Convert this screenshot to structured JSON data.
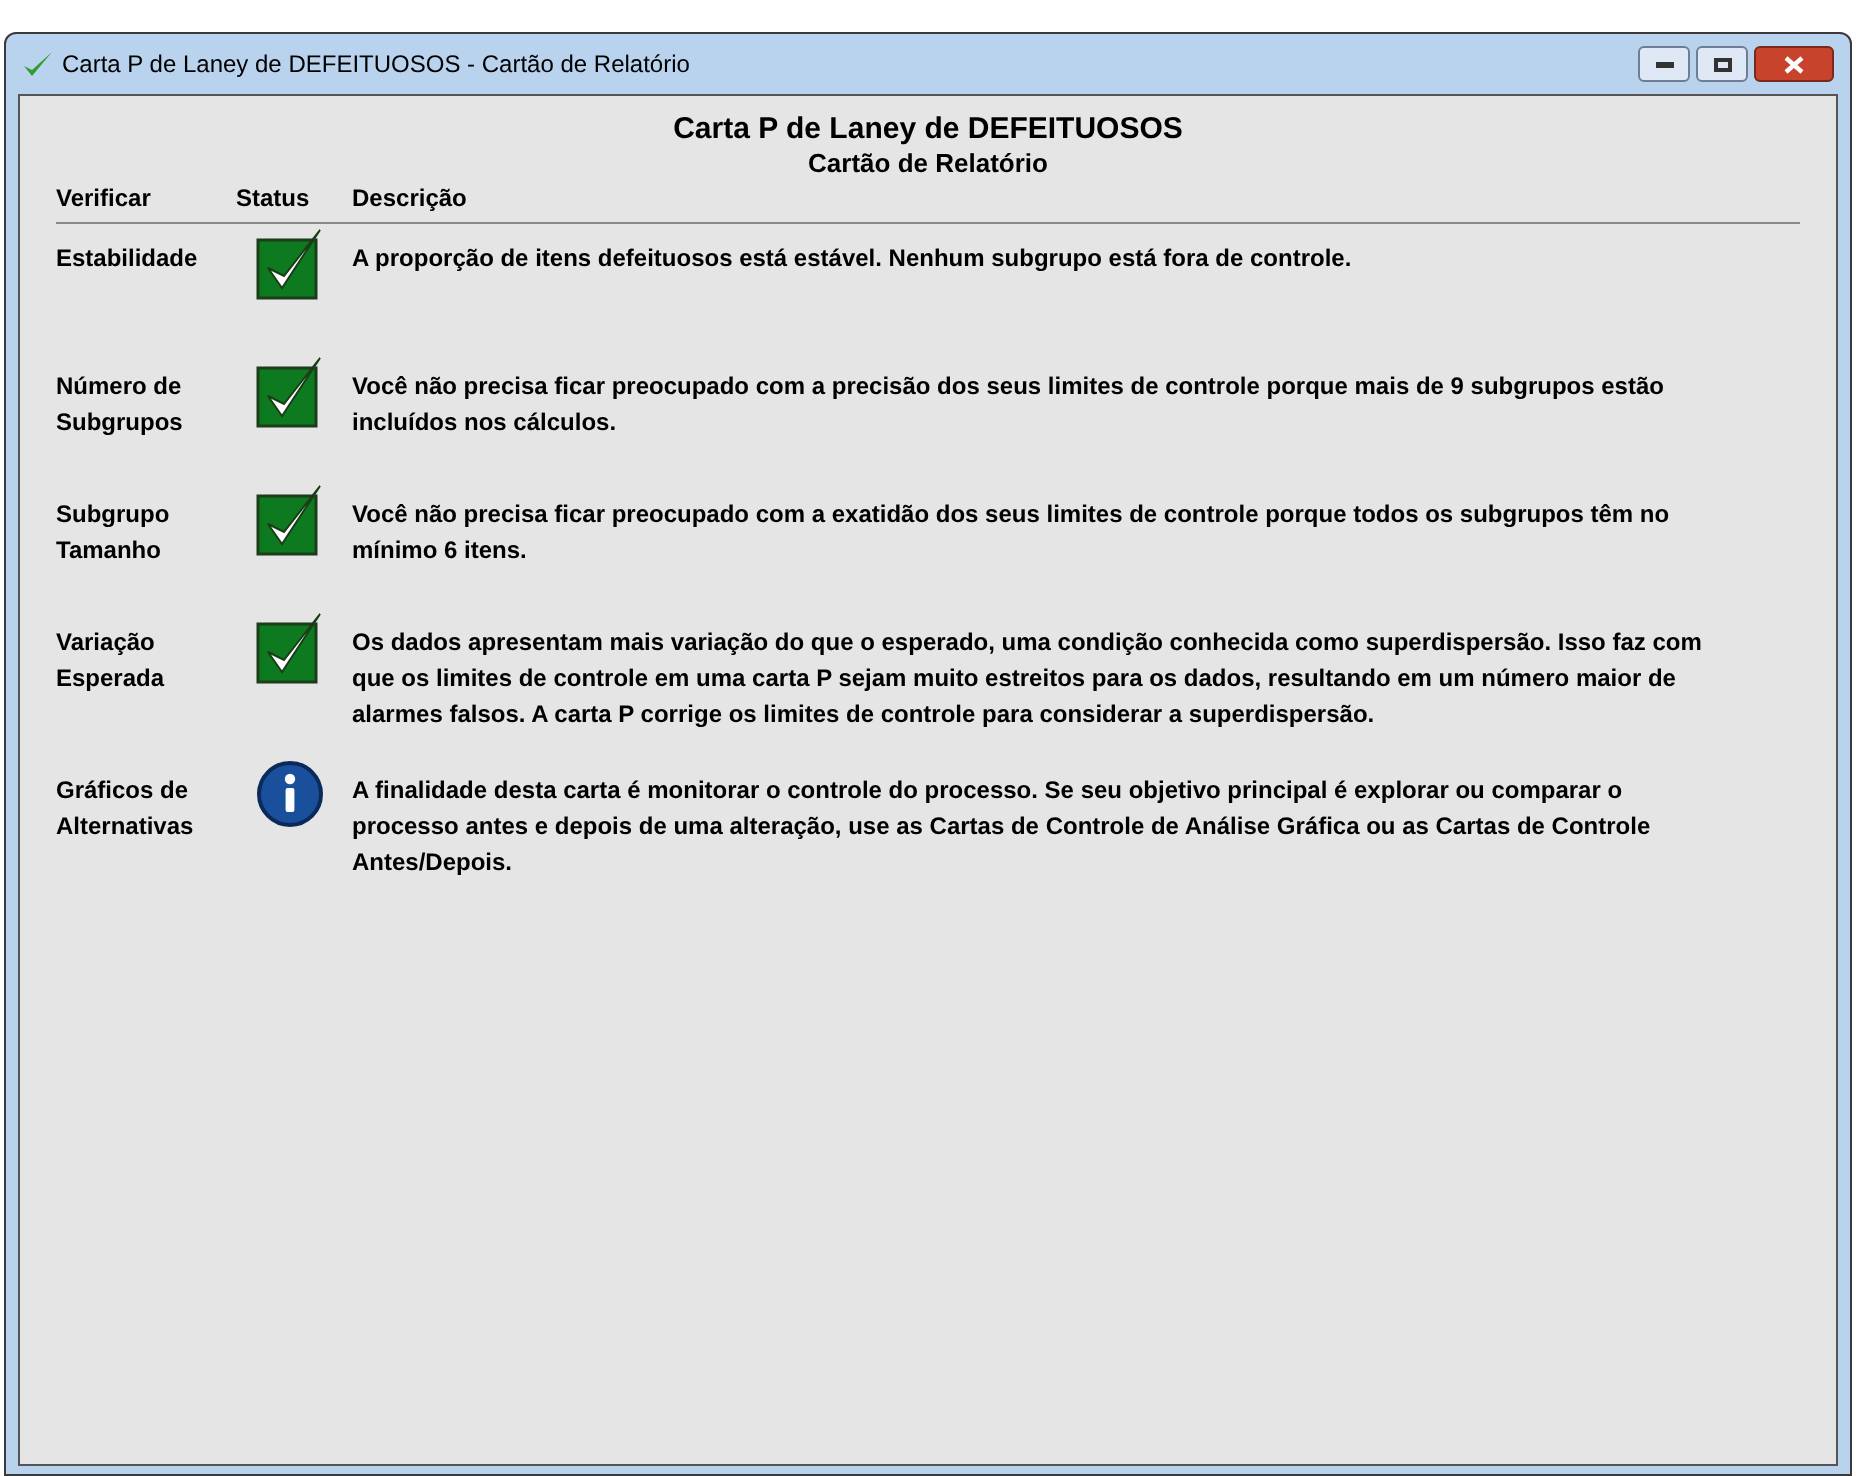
{
  "window": {
    "title": "Carta P de Laney de DEFEITUOSOS - Cartão de Relatório"
  },
  "report": {
    "title": "Carta P de Laney de DEFEITUOSOS",
    "subtitle": "Cartão de Relatório",
    "columns": [
      "Verificar",
      "Status",
      "Descrição"
    ],
    "rows": [
      {
        "check": "Estabilidade",
        "kind": "check",
        "description": "A proporção de itens defeituosos está estável. Nenhum subgrupo está fora de controle."
      },
      {
        "check": "Número de Subgrupos",
        "kind": "check",
        "description": "Você não precisa ficar preocupado com a precisão dos seus limites de controle porque mais de 9 subgrupos estão incluídos nos cálculos."
      },
      {
        "check": "Subgrupo Tamanho",
        "kind": "check",
        "description": "Você não precisa ficar preocupado com a exatidão dos seus limites de controle porque todos os subgrupos têm no mínimo 6 itens."
      },
      {
        "check": "Variação Esperada",
        "kind": "check",
        "description": "Os dados apresentam mais variação do que o esperado, uma condição conhecida como superdispersão. Isso faz com que os limites de controle em uma carta P sejam muito estreitos para os dados, resultando em um número maior de alarmes falsos. A carta P corrige os limites de controle para considerar a superdispersão."
      },
      {
        "check": "Gráficos de Alternativas",
        "kind": "info",
        "description": "A finalidade desta carta é monitorar o controle do processo. Se seu objetivo principal é explorar ou comparar o processo antes e depois de uma alteração, use as Cartas de Controle de Análise Gráfica ou as Cartas de Controle Antes/Depois."
      }
    ]
  }
}
